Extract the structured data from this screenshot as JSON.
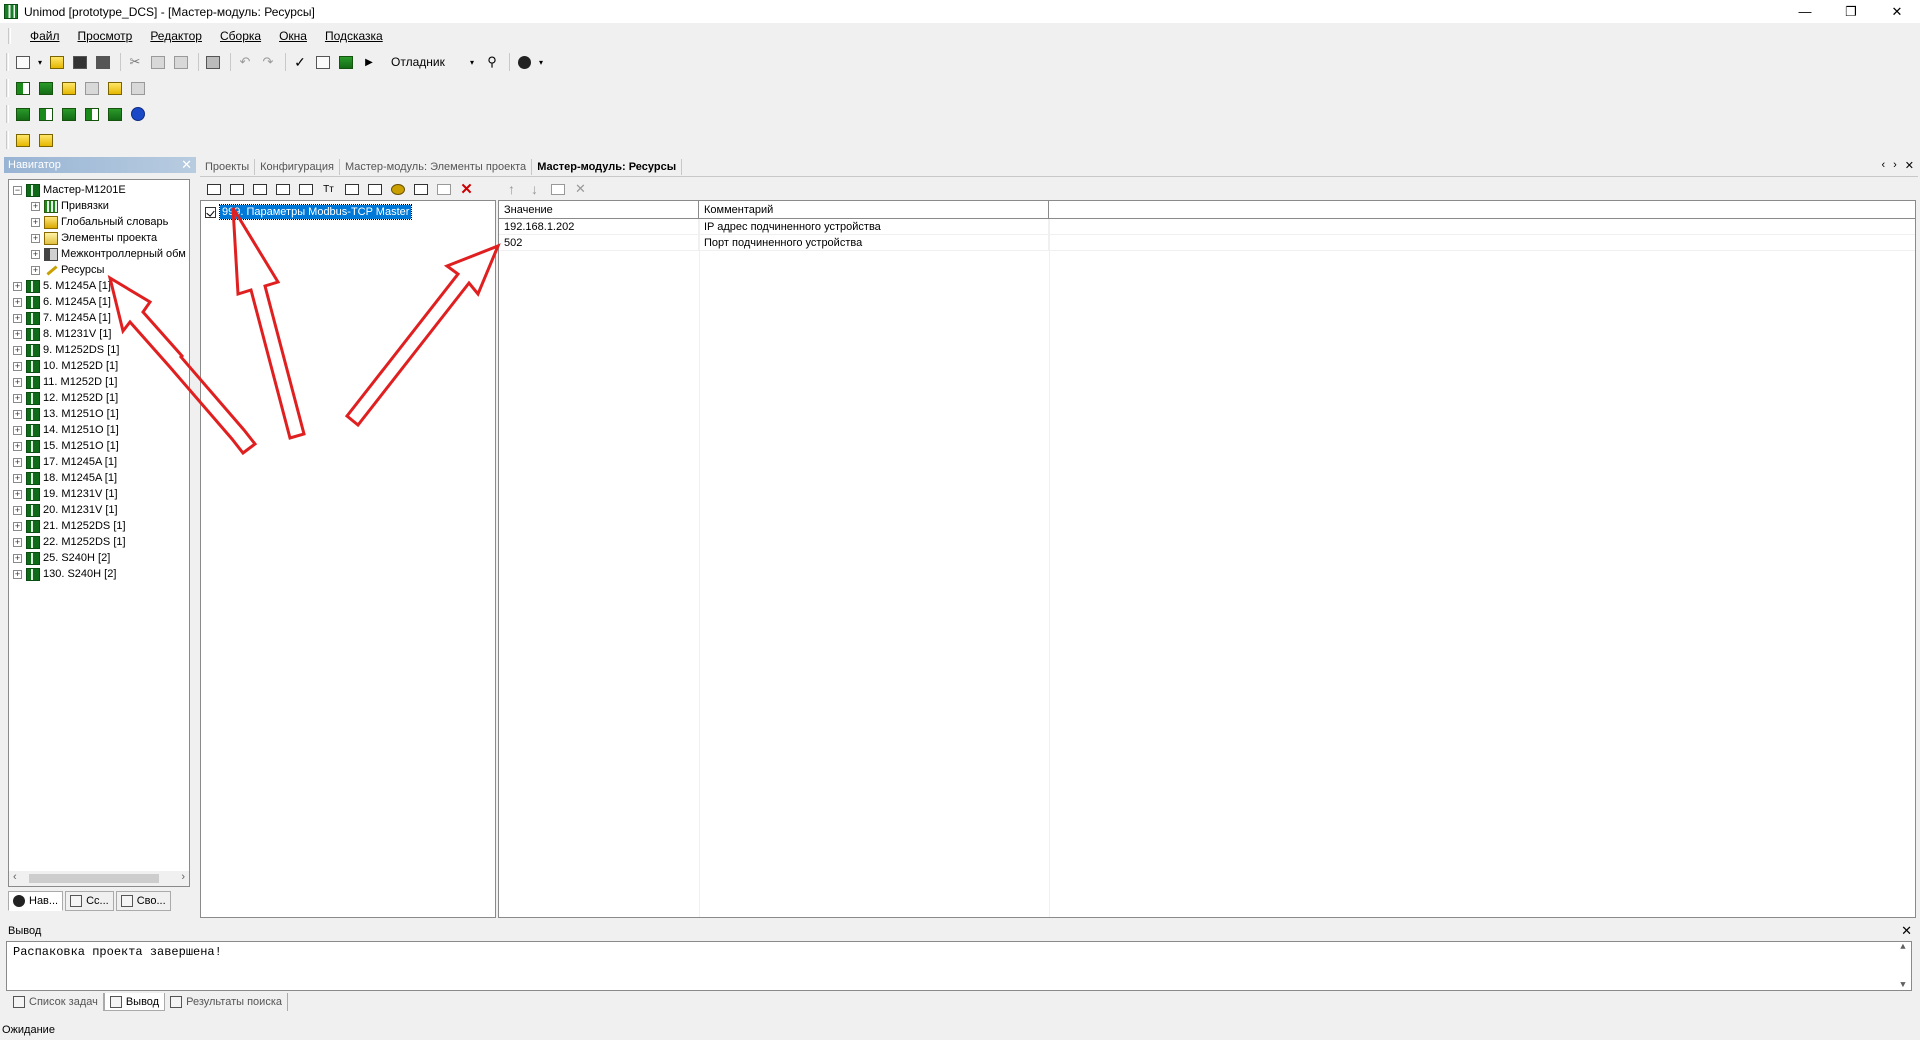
{
  "window": {
    "title": "Unimod [prototype_DCS] - [Мастер-модуль: Ресурсы]",
    "min": "—",
    "restore": "❐",
    "close": "✕"
  },
  "menu": [
    "Файл",
    "Просмотр",
    "Редактор",
    "Сборка",
    "Окна",
    "Подсказка"
  ],
  "toolbar": {
    "debugger_label": "Отладник"
  },
  "navigator": {
    "title": "Навигатор",
    "root": "Мастер-М1201Е",
    "children": [
      "Привязки",
      "Глобальный словарь",
      "Элементы проекта",
      "Межконтроллерный обм",
      "Ресурсы"
    ],
    "modules": [
      "5. M1245A [1]",
      "6. M1245A [1]",
      "7. M1245A [1]",
      "8. M1231V [1]",
      "9. M1252DS [1]",
      "10. M1252D [1]",
      "11. M1252D [1]",
      "12. M1252D [1]",
      "13. M1251O [1]",
      "14. M1251O [1]",
      "15. M1251O [1]",
      "17. M1245A [1]",
      "18. M1245A [1]",
      "19. M1231V [1]",
      "20. M1231V [1]",
      "21. M1252DS [1]",
      "22. M1252DS [1]",
      "25. S240H [2]",
      "130. S240H [2]"
    ],
    "tabs": [
      "Нав...",
      "Сс...",
      "Сво..."
    ]
  },
  "doc_tabs": [
    "Проекты",
    "Конфигурация",
    "Мастер-модуль: Элементы проекта",
    "Мастер-модуль: Ресурсы"
  ],
  "resources": {
    "selected_item": "999. Параметры Modbus-TCP Master",
    "columns": [
      "Значение",
      "Комментарий"
    ],
    "rows": [
      {
        "value": "192.168.1.202",
        "comment": "IP адрес подчиненного устройства"
      },
      {
        "value": "502",
        "comment": "Порт подчиненного устройства"
      }
    ]
  },
  "output": {
    "title": "Вывод",
    "text": "Распаковка проекта завершена!",
    "tabs": [
      "Список задач",
      "Вывод",
      "Результаты поиска"
    ]
  },
  "status": "Ожидание",
  "colors": {
    "selection": "#0078d7",
    "annotation_arrow": "#e02020"
  }
}
